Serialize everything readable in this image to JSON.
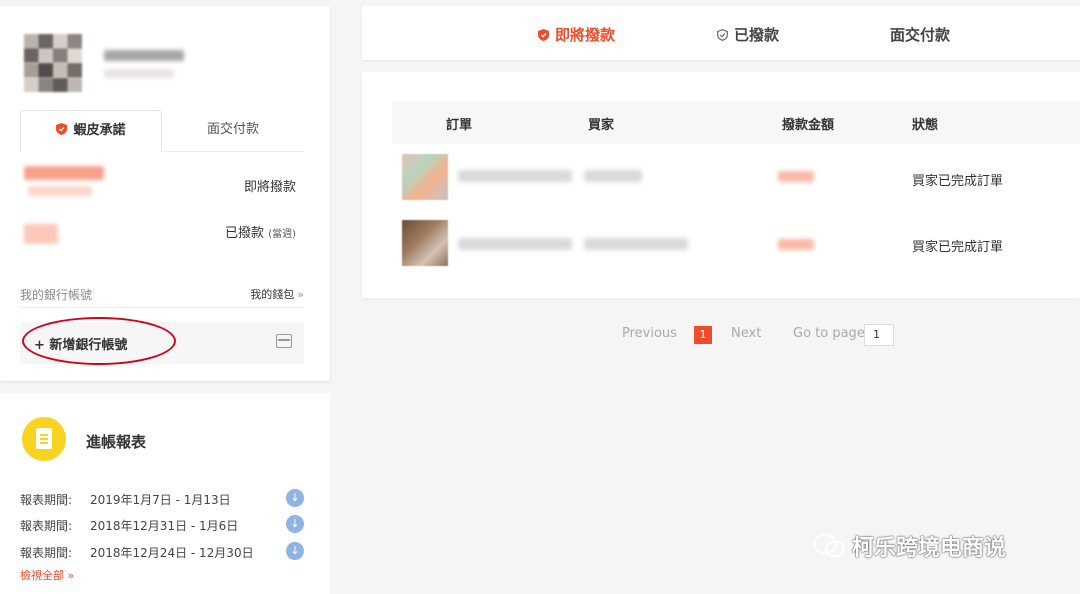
{
  "left_tabs": [
    {
      "label": "蝦皮承諾",
      "active": true
    },
    {
      "label": "面交付款",
      "active": false
    }
  ],
  "payouts": {
    "upcoming_label": "即將撥款",
    "paid_label": "已撥款",
    "paid_note": "(當週)"
  },
  "bank": {
    "my_bank_label": "我的銀行帳號",
    "my_wallet_link": "我的錢包",
    "wallet_chevron": "»",
    "add_bank_label": "+ 新增銀行帳號"
  },
  "report": {
    "title": "進帳報表",
    "rows": [
      {
        "key": "報表期間:",
        "value": "2019年1月7日 - 1月13日"
      },
      {
        "key": "報表期間:",
        "value": "2018年12月31日 - 1月6日"
      },
      {
        "key": "報表期間:",
        "value": "2018年12月24日 - 12月30日"
      }
    ],
    "view_all": "檢視全部 »"
  },
  "top_tabs": [
    {
      "label": "即將撥款",
      "active": true,
      "icon": "shield-icon"
    },
    {
      "label": "已撥款",
      "active": false,
      "icon": "shield-icon"
    },
    {
      "label": "面交付款",
      "active": false
    }
  ],
  "table": {
    "headers": [
      "訂單",
      "買家",
      "撥款金額",
      "狀態"
    ],
    "rows": [
      {
        "status": "買家已完成訂單"
      },
      {
        "status": "買家已完成訂單"
      }
    ]
  },
  "pagination": {
    "previous": "Previous",
    "current_page": "1",
    "next": "Next",
    "goto_label": "Go to page",
    "goto_value": "1"
  },
  "watermark": "柯乐跨境电商说",
  "colors": {
    "accent": "#ee4d2d",
    "annotation": "#d0021b",
    "report_icon": "#f8d31f",
    "download_icon": "#8fb4e3"
  }
}
